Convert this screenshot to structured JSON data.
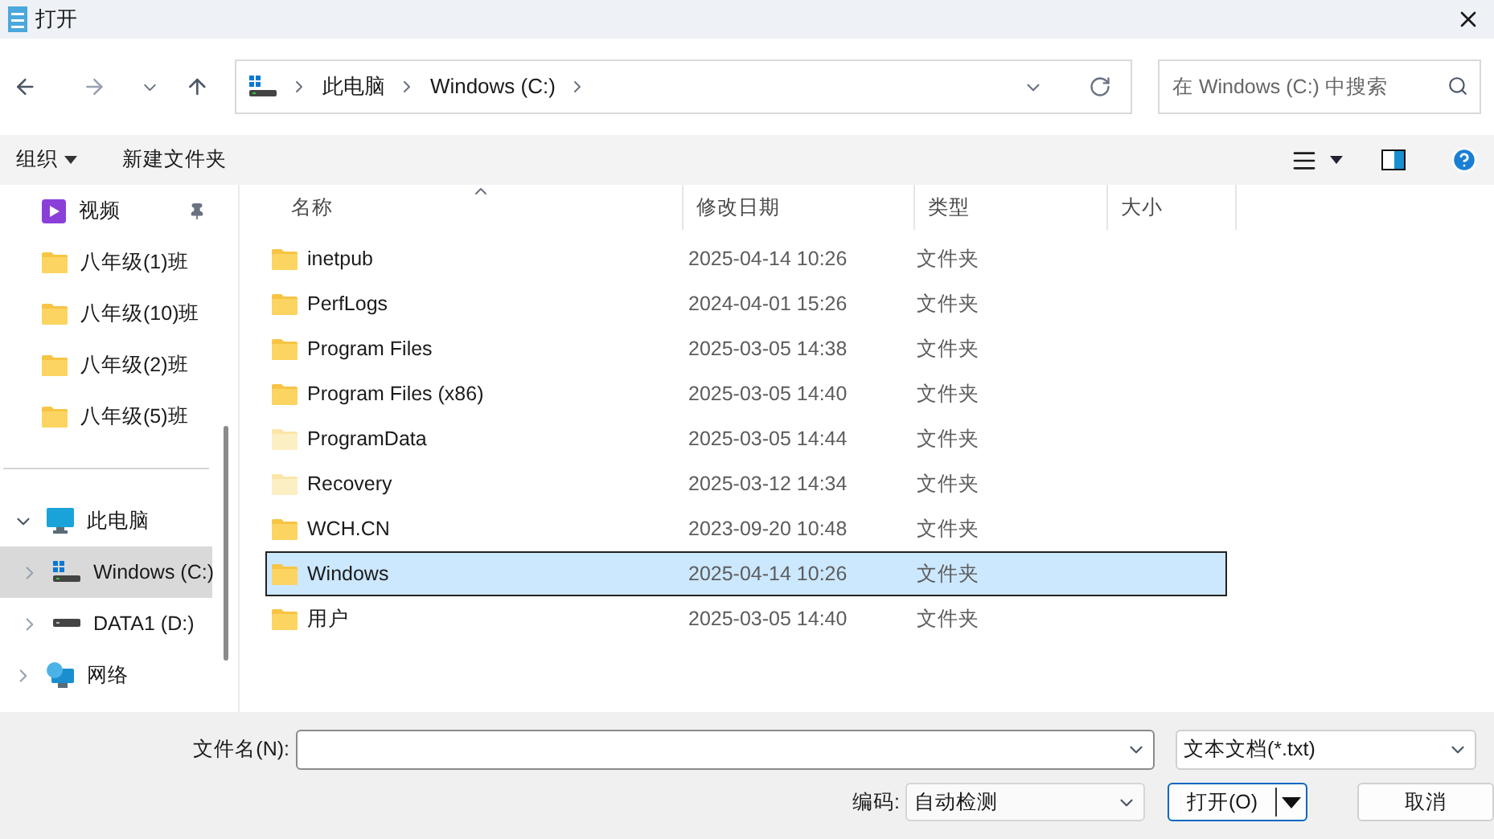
{
  "window": {
    "title": "打开"
  },
  "address": {
    "crumbs": [
      "此电脑",
      "Windows (C:)"
    ]
  },
  "search": {
    "placeholder": "在 Windows (C:) 中搜索"
  },
  "toolbar": {
    "organize": "组织",
    "new_folder": "新建文件夹"
  },
  "sidebar": {
    "quick": [
      {
        "label": "视频",
        "kind": "video",
        "pinned": true
      },
      {
        "label": "八年级(1)班",
        "kind": "folder",
        "pinned": false
      },
      {
        "label": "八年级(10)班",
        "kind": "folder",
        "pinned": false
      },
      {
        "label": "八年级(2)班",
        "kind": "folder",
        "pinned": false
      },
      {
        "label": "八年级(5)班",
        "kind": "folder",
        "pinned": false
      }
    ],
    "tree": [
      {
        "label": "此电脑",
        "kind": "pc",
        "expanded": true,
        "selected": false,
        "children": [
          {
            "label": "Windows (C:)",
            "kind": "windrive",
            "expanded": false,
            "selected": true
          },
          {
            "label": "DATA1 (D:)",
            "kind": "drive",
            "expanded": false,
            "selected": false
          }
        ]
      },
      {
        "label": "网络",
        "kind": "network",
        "expanded": false,
        "selected": false
      }
    ]
  },
  "table": {
    "columns": [
      "名称",
      "修改日期",
      "类型",
      "大小"
    ],
    "rows": [
      {
        "name": "inetpub",
        "date": "2025-04-14 10:26",
        "type": "文件夹",
        "hidden": false,
        "selected": false
      },
      {
        "name": "PerfLogs",
        "date": "2024-04-01 15:26",
        "type": "文件夹",
        "hidden": false,
        "selected": false
      },
      {
        "name": "Program Files",
        "date": "2025-03-05 14:38",
        "type": "文件夹",
        "hidden": false,
        "selected": false
      },
      {
        "name": "Program Files (x86)",
        "date": "2025-03-05 14:40",
        "type": "文件夹",
        "hidden": false,
        "selected": false
      },
      {
        "name": "ProgramData",
        "date": "2025-03-05 14:44",
        "type": "文件夹",
        "hidden": true,
        "selected": false
      },
      {
        "name": "Recovery",
        "date": "2025-03-12 14:34",
        "type": "文件夹",
        "hidden": true,
        "selected": false
      },
      {
        "name": "WCH.CN",
        "date": "2023-09-20 10:48",
        "type": "文件夹",
        "hidden": false,
        "selected": false
      },
      {
        "name": "Windows",
        "date": "2025-04-14 10:26",
        "type": "文件夹",
        "hidden": false,
        "selected": true
      },
      {
        "name": "用户",
        "date": "2025-03-05 14:40",
        "type": "文件夹",
        "hidden": false,
        "selected": false
      }
    ]
  },
  "footer": {
    "filename_label": "文件名(N):",
    "filter": "文本文档(*.txt)",
    "encoding_label": "编码:",
    "encoding": "自动检测",
    "open": "打开(O)",
    "cancel": "取消"
  }
}
